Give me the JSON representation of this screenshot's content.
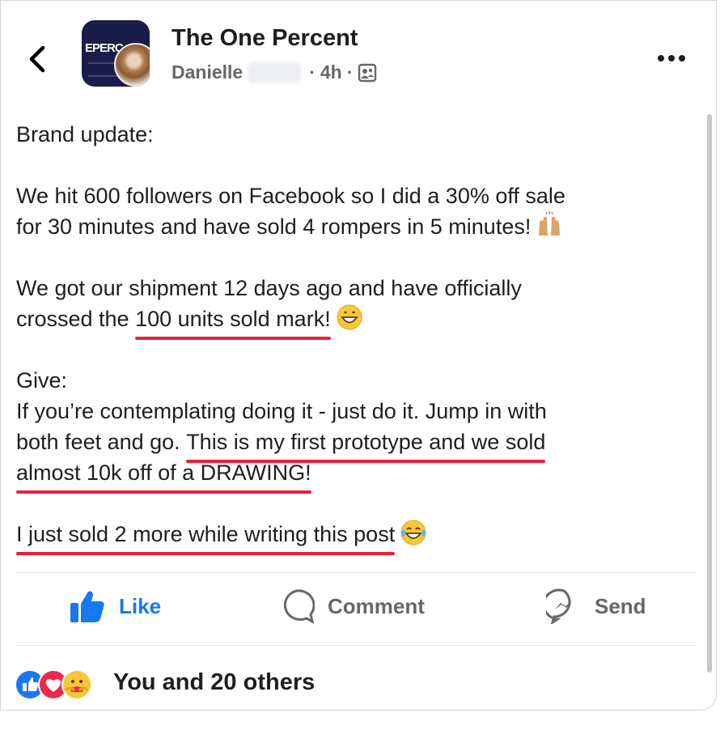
{
  "header": {
    "page_name": "The One Percent",
    "author": "Danielle",
    "time": "4h",
    "separator": "·",
    "avatar_text": "EPERC"
  },
  "post": {
    "line1": "Brand update:",
    "line2": "We hit 600 followers on Facebook so I did a 30% off sale",
    "line3": "for 30 minutes and have sold 4 rompers in 5 minutes!",
    "line4": "We got our shipment 12 days ago and have officially",
    "line5_pre": "crossed the ",
    "line5_ul": "100 units sold mark!",
    "line6": "Give:",
    "line7": "If you’re contemplating doing it - just do it. Jump in with",
    "line8_pre": "both feet and go. ",
    "line8_ul": "This is my first prototype and we sold",
    "line9_ul": "almost 10k off of a DRAWING!",
    "line10_ul": "I just sold 2 more while writing this post",
    "emojis": [
      "raising-hands-emoji",
      "grinning-emoji",
      "tears-of-joy-emoji"
    ]
  },
  "actions": {
    "like": "Like",
    "comment": "Comment",
    "send": "Send"
  },
  "reactions": {
    "summary": "You and 20 others",
    "icons": [
      "like-reaction-icon",
      "love-reaction-icon",
      "care-reaction-icon"
    ]
  },
  "colors": {
    "accent": "#1877f2",
    "underline": "#e8203a",
    "secondary_text": "#65676b"
  }
}
